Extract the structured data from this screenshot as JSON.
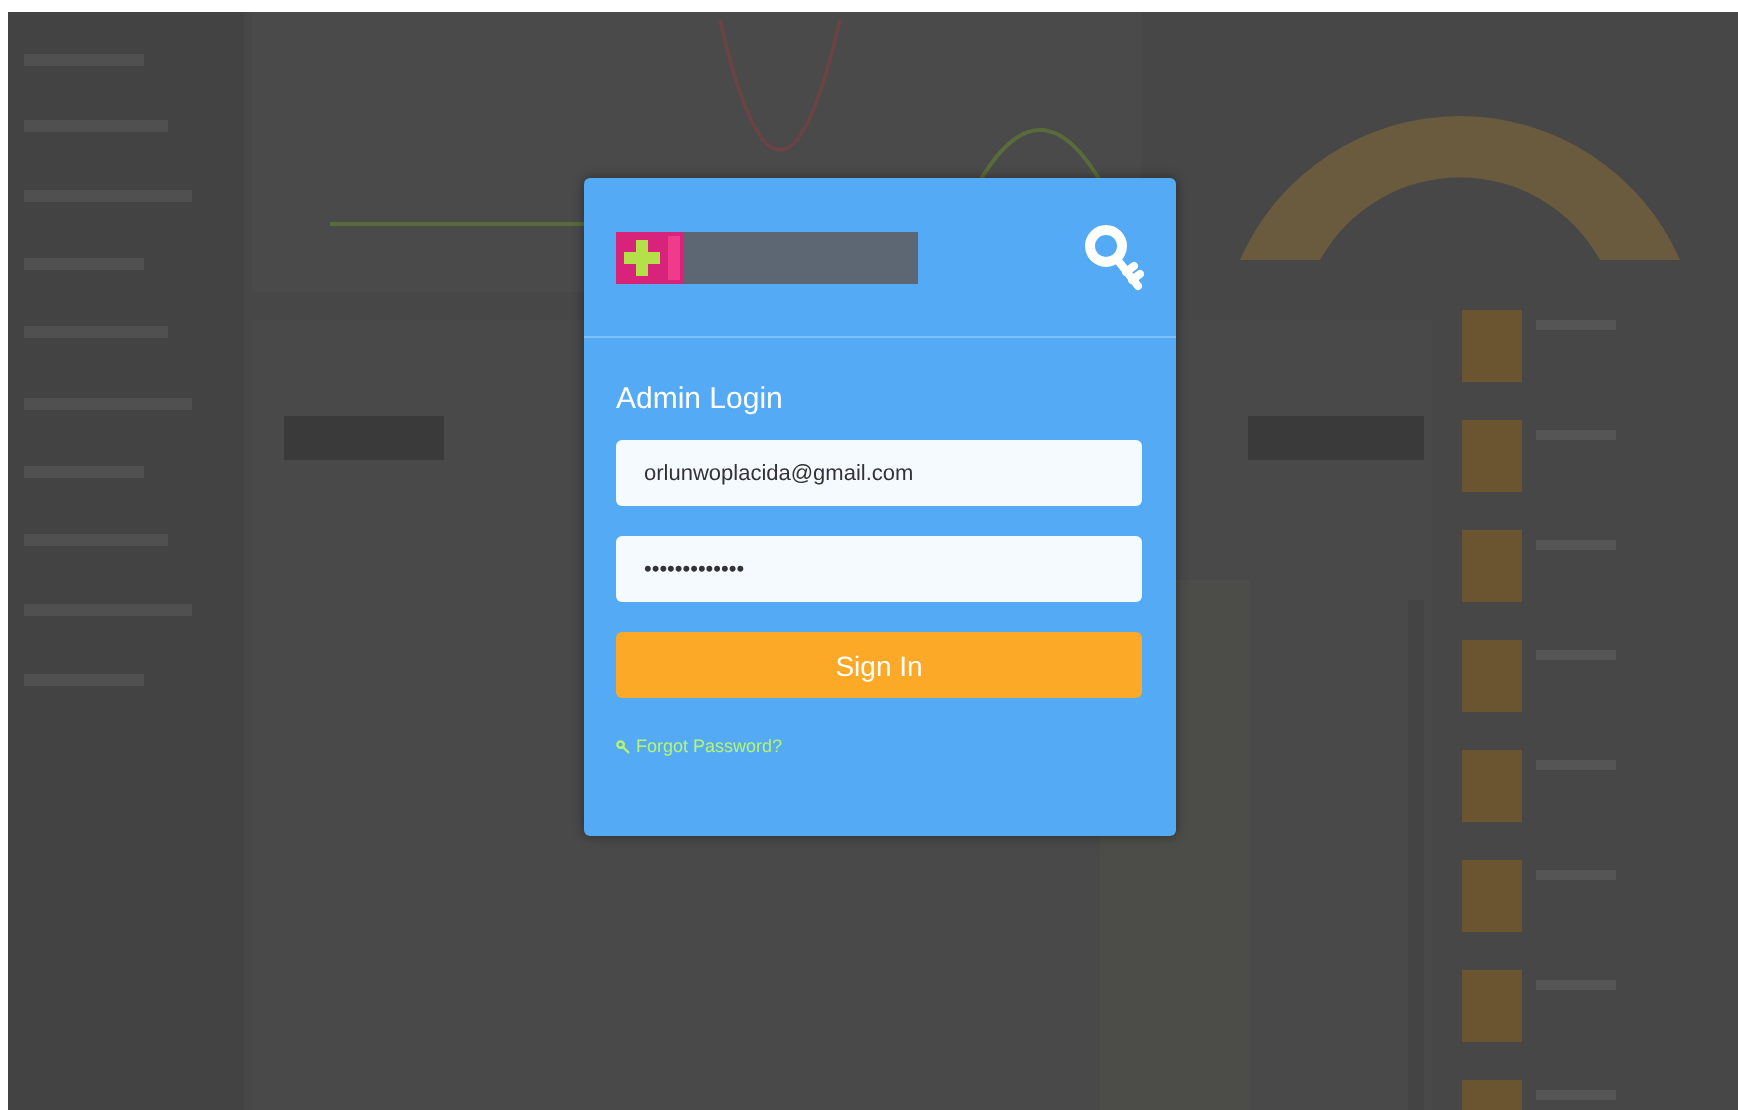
{
  "login": {
    "title": "Admin Login",
    "email": {
      "value": "orlunwoplacida@gmail.com"
    },
    "password": {
      "value": "•••••••••••••"
    },
    "submit": "Sign In",
    "forgot_link": "Forgot Password?"
  }
}
